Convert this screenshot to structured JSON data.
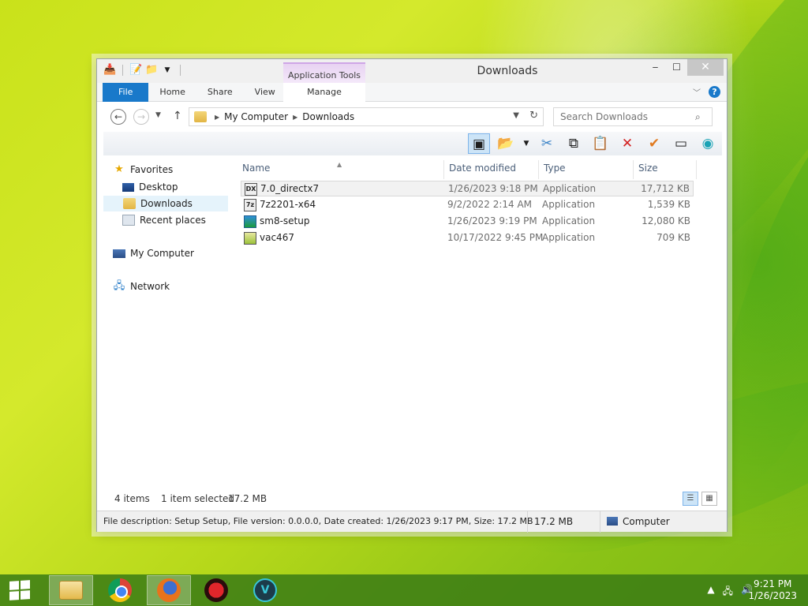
{
  "window": {
    "title": "Downloads",
    "context_tab": "Application Tools",
    "ribbon_tabs": [
      "File",
      "Home",
      "Share",
      "View",
      "Manage"
    ]
  },
  "nav": {
    "breadcrumb": [
      "My Computer",
      "Downloads"
    ],
    "search_placeholder": "Search Downloads"
  },
  "sidebar": {
    "favorites": "Favorites",
    "items": [
      "Desktop",
      "Downloads",
      "Recent places"
    ],
    "computer": "My Computer",
    "network": "Network"
  },
  "columns": [
    "Name",
    "Date modified",
    "Type",
    "Size"
  ],
  "files": [
    {
      "name": "7.0_directx7",
      "date": "1/26/2023 9:18 PM",
      "type": "Application",
      "size": "17,712 KB"
    },
    {
      "name": "7z2201-x64",
      "date": "9/2/2022 2:14 AM",
      "type": "Application",
      "size": "1,539 KB"
    },
    {
      "name": "sm8-setup",
      "date": "1/26/2023 9:19 PM",
      "type": "Application",
      "size": "12,080 KB"
    },
    {
      "name": "vac467",
      "date": "10/17/2022 9:45 PM",
      "type": "Application",
      "size": "709 KB"
    }
  ],
  "status": {
    "items": "4 items",
    "selected": "1 item selected",
    "selected_size": "17.2 MB"
  },
  "details": {
    "description": "File description: Setup Setup, File version: 0.0.0.0, Date created: 1/26/2023 9:17 PM, Size: 17.2 MB",
    "size": "17.2 MB",
    "location": "Computer"
  },
  "taskbar": {
    "time": "9:21 PM",
    "date": "1/26/2023"
  }
}
